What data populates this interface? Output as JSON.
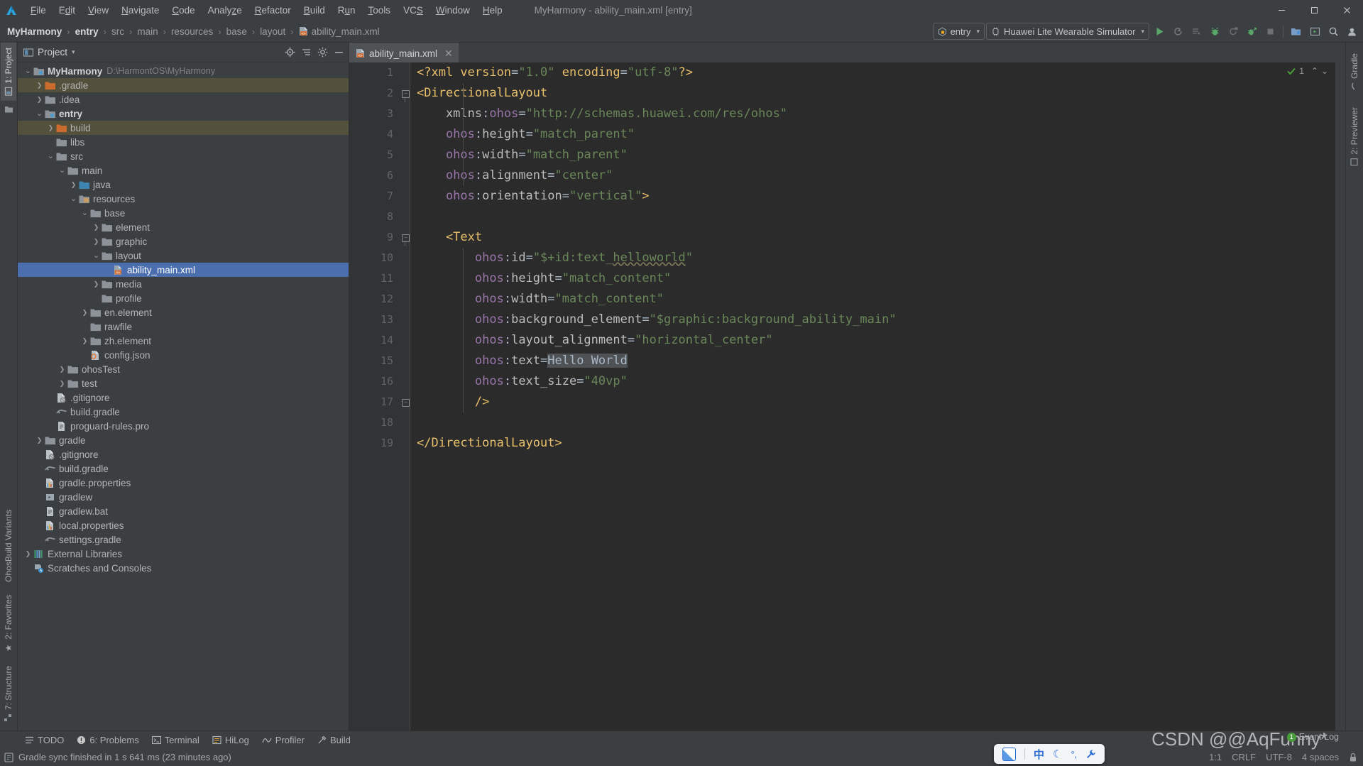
{
  "window": {
    "title": "MyHarmony - ability_main.xml [entry]",
    "controls": {
      "minimize": "—",
      "maximize": "▢",
      "close": "✕"
    }
  },
  "menu": {
    "items": [
      {
        "label": "File"
      },
      {
        "label": "Edit"
      },
      {
        "label": "View"
      },
      {
        "label": "Navigate"
      },
      {
        "label": "Code"
      },
      {
        "label": "Analyze"
      },
      {
        "label": "Refactor"
      },
      {
        "label": "Build"
      },
      {
        "label": "Run"
      },
      {
        "label": "Tools"
      },
      {
        "label": "VCS"
      },
      {
        "label": "Window"
      },
      {
        "label": "Help"
      }
    ]
  },
  "breadcrumb": {
    "items": [
      {
        "label": "MyHarmony",
        "bold": true
      },
      {
        "label": "entry",
        "bold": true
      },
      {
        "label": "src",
        "bold": false
      },
      {
        "label": "main",
        "bold": false
      },
      {
        "label": "resources",
        "bold": false
      },
      {
        "label": "base",
        "bold": false
      },
      {
        "label": "layout",
        "bold": false
      },
      {
        "label": "ability_main.xml",
        "bold": false
      }
    ],
    "separator": "›"
  },
  "toolbar": {
    "run_config": "entry",
    "device": "Huawei Lite Wearable Simulator",
    "caret": "▾",
    "icons": [
      "run-icon",
      "rerun-icon",
      "run-with-coverage-icon",
      "debug-icon",
      "attach-debugger-icon",
      "profile-icon",
      "stop-icon",
      "project-structure-icon",
      "device-manager-icon",
      "search-everywhere-icon",
      "account-icon"
    ]
  },
  "left_strip": {
    "tabs": [
      {
        "label": "1: Project",
        "selected": true
      },
      {
        "label": "7: Structure",
        "selected": false
      },
      {
        "label": "2: Favorites",
        "selected": false
      },
      {
        "label": "OhosBuild Variants",
        "selected": false
      }
    ]
  },
  "right_strip": {
    "tabs": [
      {
        "label": "Gradle"
      },
      {
        "label": "2: Previewer"
      }
    ]
  },
  "project_panel": {
    "title": "Project",
    "caret": "▾",
    "actions": [
      "locate-icon",
      "collapse-all-icon",
      "settings-icon",
      "hide-icon"
    ],
    "tree": [
      {
        "indent": 0,
        "arrow": "down",
        "icon": "module",
        "label": "MyHarmony",
        "sub": "D:\\HarmontOS\\MyHarmony",
        "bold": true
      },
      {
        "indent": 1,
        "arrow": "right",
        "icon": "folder-orange",
        "label": ".gradle",
        "excluded": true
      },
      {
        "indent": 1,
        "arrow": "right",
        "icon": "folder",
        "label": ".idea"
      },
      {
        "indent": 1,
        "arrow": "down",
        "icon": "module",
        "label": "entry",
        "bold": true
      },
      {
        "indent": 2,
        "arrow": "right",
        "icon": "folder-orange",
        "label": "build",
        "excluded": true
      },
      {
        "indent": 2,
        "arrow": "none",
        "icon": "folder",
        "label": "libs"
      },
      {
        "indent": 2,
        "arrow": "down",
        "icon": "folder",
        "label": "src"
      },
      {
        "indent": 3,
        "arrow": "down",
        "icon": "folder",
        "label": "main"
      },
      {
        "indent": 4,
        "arrow": "right",
        "icon": "folder-blue",
        "label": "java"
      },
      {
        "indent": 4,
        "arrow": "down",
        "icon": "folder-res",
        "label": "resources"
      },
      {
        "indent": 5,
        "arrow": "down",
        "icon": "folder",
        "label": "base"
      },
      {
        "indent": 6,
        "arrow": "right",
        "icon": "folder",
        "label": "element"
      },
      {
        "indent": 6,
        "arrow": "right",
        "icon": "folder",
        "label": "graphic"
      },
      {
        "indent": 6,
        "arrow": "down",
        "icon": "folder",
        "label": "layout"
      },
      {
        "indent": 7,
        "arrow": "none",
        "icon": "xml-file",
        "label": "ability_main.xml",
        "selected": true
      },
      {
        "indent": 6,
        "arrow": "right",
        "icon": "folder",
        "label": "media"
      },
      {
        "indent": 6,
        "arrow": "none",
        "icon": "folder",
        "label": "profile"
      },
      {
        "indent": 5,
        "arrow": "right",
        "icon": "folder",
        "label": "en.element"
      },
      {
        "indent": 5,
        "arrow": "none",
        "icon": "folder",
        "label": "rawfile"
      },
      {
        "indent": 5,
        "arrow": "right",
        "icon": "folder",
        "label": "zh.element"
      },
      {
        "indent": 5,
        "arrow": "none",
        "icon": "json-file",
        "label": "config.json"
      },
      {
        "indent": 3,
        "arrow": "right",
        "icon": "folder",
        "label": "ohosTest"
      },
      {
        "indent": 3,
        "arrow": "right",
        "icon": "folder",
        "label": "test"
      },
      {
        "indent": 2,
        "arrow": "none",
        "icon": "gitignore-file",
        "label": ".gitignore"
      },
      {
        "indent": 2,
        "arrow": "none",
        "icon": "gradle-file",
        "label": "build.gradle"
      },
      {
        "indent": 2,
        "arrow": "none",
        "icon": "text-file",
        "label": "proguard-rules.pro"
      },
      {
        "indent": 1,
        "arrow": "right",
        "icon": "folder",
        "label": "gradle"
      },
      {
        "indent": 1,
        "arrow": "none",
        "icon": "gitignore-file",
        "label": ".gitignore"
      },
      {
        "indent": 1,
        "arrow": "none",
        "icon": "gradle-file",
        "label": "build.gradle"
      },
      {
        "indent": 1,
        "arrow": "none",
        "icon": "properties-file",
        "label": "gradle.properties"
      },
      {
        "indent": 1,
        "arrow": "none",
        "icon": "script-file",
        "label": "gradlew"
      },
      {
        "indent": 1,
        "arrow": "none",
        "icon": "text-file",
        "label": "gradlew.bat"
      },
      {
        "indent": 1,
        "arrow": "none",
        "icon": "properties-file",
        "label": "local.properties"
      },
      {
        "indent": 1,
        "arrow": "none",
        "icon": "gradle-file",
        "label": "settings.gradle"
      },
      {
        "indent": 0,
        "arrow": "right",
        "icon": "libraries",
        "label": "External Libraries"
      },
      {
        "indent": 0,
        "arrow": "none",
        "icon": "scratches",
        "label": "Scratches and Consoles"
      }
    ]
  },
  "editor": {
    "tab": {
      "label": "ability_main.xml",
      "close": "✕",
      "icon": "xml-file"
    },
    "inspection": {
      "count": "1",
      "ok_icon": "check-icon",
      "up": "⌃",
      "down": "⌄"
    },
    "lines": [
      {
        "n": "1",
        "tokens": [
          {
            "t": "proc",
            "v": "<?xml "
          },
          {
            "t": "proc",
            "v": "version"
          },
          {
            "t": "punc",
            "v": "="
          },
          {
            "t": "str",
            "v": "\"1.0\""
          },
          {
            "t": "proc",
            "v": " encoding"
          },
          {
            "t": "punc",
            "v": "="
          },
          {
            "t": "str",
            "v": "\"utf-8\""
          },
          {
            "t": "proc",
            "v": "?>"
          }
        ]
      },
      {
        "n": "2",
        "tokens": [
          {
            "t": "tag",
            "v": "<DirectionalLayout"
          }
        ]
      },
      {
        "n": "3",
        "tokens": [
          {
            "t": "ns",
            "v": "    xmlns"
          },
          {
            "t": "punc",
            "v": ":"
          },
          {
            "t": "attr",
            "v": "ohos"
          },
          {
            "t": "punc",
            "v": "="
          },
          {
            "t": "str",
            "v": "\"http://schemas.huawei.com/res/ohos\""
          }
        ]
      },
      {
        "n": "4",
        "tokens": [
          {
            "t": "attr",
            "v": "    ohos"
          },
          {
            "t": "punc",
            "v": ":"
          },
          {
            "t": "ns",
            "v": "height"
          },
          {
            "t": "punc",
            "v": "="
          },
          {
            "t": "str",
            "v": "\"match_parent\""
          }
        ]
      },
      {
        "n": "5",
        "tokens": [
          {
            "t": "attr",
            "v": "    ohos"
          },
          {
            "t": "punc",
            "v": ":"
          },
          {
            "t": "ns",
            "v": "width"
          },
          {
            "t": "punc",
            "v": "="
          },
          {
            "t": "str",
            "v": "\"match_parent\""
          }
        ]
      },
      {
        "n": "6",
        "tokens": [
          {
            "t": "attr",
            "v": "    ohos"
          },
          {
            "t": "punc",
            "v": ":"
          },
          {
            "t": "ns",
            "v": "alignment"
          },
          {
            "t": "punc",
            "v": "="
          },
          {
            "t": "str",
            "v": "\"center\""
          }
        ]
      },
      {
        "n": "7",
        "tokens": [
          {
            "t": "attr",
            "v": "    ohos"
          },
          {
            "t": "punc",
            "v": ":"
          },
          {
            "t": "ns",
            "v": "orientation"
          },
          {
            "t": "punc",
            "v": "="
          },
          {
            "t": "str",
            "v": "\"vertical\""
          },
          {
            "t": "tag",
            "v": ">"
          }
        ]
      },
      {
        "n": "8",
        "tokens": []
      },
      {
        "n": "9",
        "tokens": [
          {
            "t": "tag",
            "v": "    <Text"
          }
        ]
      },
      {
        "n": "10",
        "tokens": [
          {
            "t": "attr",
            "v": "        ohos"
          },
          {
            "t": "punc",
            "v": ":"
          },
          {
            "t": "ns",
            "v": "id"
          },
          {
            "t": "punc",
            "v": "="
          },
          {
            "t": "str",
            "v": "\"$+id:text_"
          },
          {
            "t": "str-squig",
            "v": "helloworld"
          },
          {
            "t": "str",
            "v": "\""
          }
        ]
      },
      {
        "n": "11",
        "tokens": [
          {
            "t": "attr",
            "v": "        ohos"
          },
          {
            "t": "punc",
            "v": ":"
          },
          {
            "t": "ns",
            "v": "height"
          },
          {
            "t": "punc",
            "v": "="
          },
          {
            "t": "str",
            "v": "\"match_content\""
          }
        ]
      },
      {
        "n": "12",
        "tokens": [
          {
            "t": "attr",
            "v": "        ohos"
          },
          {
            "t": "punc",
            "v": ":"
          },
          {
            "t": "ns",
            "v": "width"
          },
          {
            "t": "punc",
            "v": "="
          },
          {
            "t": "str",
            "v": "\"match_content\""
          }
        ]
      },
      {
        "n": "13",
        "tokens": [
          {
            "t": "attr",
            "v": "        ohos"
          },
          {
            "t": "punc",
            "v": ":"
          },
          {
            "t": "ns",
            "v": "background_element"
          },
          {
            "t": "punc",
            "v": "="
          },
          {
            "t": "str",
            "v": "\"$graphic:background_ability_main\""
          }
        ]
      },
      {
        "n": "14",
        "tokens": [
          {
            "t": "attr",
            "v": "        ohos"
          },
          {
            "t": "punc",
            "v": ":"
          },
          {
            "t": "ns",
            "v": "layout_alignment"
          },
          {
            "t": "punc",
            "v": "="
          },
          {
            "t": "str",
            "v": "\"horizontal_center\""
          }
        ]
      },
      {
        "n": "15",
        "tokens": [
          {
            "t": "attr",
            "v": "        ohos"
          },
          {
            "t": "punc",
            "v": ":"
          },
          {
            "t": "ns",
            "v": "text"
          },
          {
            "t": "punc",
            "v": "="
          },
          {
            "t": "plain-hl",
            "v": "Hello World"
          }
        ]
      },
      {
        "n": "16",
        "tokens": [
          {
            "t": "attr",
            "v": "        ohos"
          },
          {
            "t": "punc",
            "v": ":"
          },
          {
            "t": "ns",
            "v": "text_size"
          },
          {
            "t": "punc",
            "v": "="
          },
          {
            "t": "str",
            "v": "\"40vp\""
          }
        ]
      },
      {
        "n": "17",
        "tokens": [
          {
            "t": "tag",
            "v": "        />"
          }
        ]
      },
      {
        "n": "18",
        "tokens": []
      },
      {
        "n": "19",
        "tokens": [
          {
            "t": "tag",
            "v": "</DirectionalLayout>"
          }
        ]
      }
    ]
  },
  "bottom_bar": {
    "items": [
      {
        "label": "TODO",
        "icon": "todo-icon"
      },
      {
        "label": "6: Problems",
        "icon": "problems-icon"
      },
      {
        "label": "Terminal",
        "icon": "terminal-icon"
      },
      {
        "label": "HiLog",
        "icon": "hilog-icon"
      },
      {
        "label": "Profiler",
        "icon": "profiler-icon"
      },
      {
        "label": "Build",
        "icon": "build-icon"
      }
    ]
  },
  "status_bar": {
    "message": "Gradle sync finished in 1 s 641 ms (23 minutes ago)",
    "message_icon": "console-icon",
    "event_log": "Event Log",
    "event_log_badge": "1",
    "position": "1:1",
    "line_separator": "CRLF",
    "encoding": "UTF-8",
    "indent": "4 spaces",
    "lock_icon": "lock-icon"
  },
  "ime_bar": {
    "items": [
      "pen-icon",
      "中",
      "moon-icon",
      "comma-icon",
      "wrench-icon"
    ]
  },
  "watermark": "CSDN @@AqFunny*",
  "colors": {
    "bg_chrome": "#3c3f41",
    "bg_editor": "#2b2b2b",
    "gutter": "#313335",
    "selection": "#4b6eaf",
    "excluded": "#53503c",
    "tag": "#e8bf6a",
    "attr": "#9876aa",
    "string": "#6a8759",
    "plain": "#a9b7c6",
    "accent_green": "#4a9c3c"
  }
}
